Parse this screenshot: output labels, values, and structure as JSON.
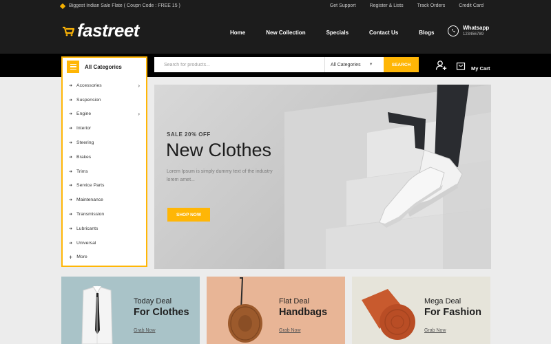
{
  "topbar": {
    "promo": "Biggest Indian Sale Flate ( Coupn Code : FREE 15 )",
    "links": [
      "Get Support",
      "Register & Lists",
      "Track Orders",
      "Credit Card"
    ]
  },
  "header": {
    "logo": "fastreet",
    "nav": [
      "Home",
      "New Collection",
      "Specials",
      "Contact Us",
      "Blogs"
    ],
    "whatsapp_title": "Whatsapp",
    "whatsapp_number": "123456789"
  },
  "categories": {
    "title": "All Categories",
    "items": [
      "Accessories",
      "Suspension",
      "Engine",
      "Interior",
      "Steering",
      "Brakes",
      "Trims",
      "Service Parts",
      "Maintenance",
      "Transmission",
      "Lubricants",
      "Universal"
    ],
    "more": "More"
  },
  "search": {
    "placeholder": "Search for products...",
    "category": "All Categories",
    "button": "SEARCH"
  },
  "cart": {
    "count": "0",
    "label": "My Cart"
  },
  "hero": {
    "kicker": "SALE 20% OFF",
    "title": "New Clothes",
    "description": "Lorem Ipsum is simply dummy text of the industry lorem amet...",
    "button": "SHOP NOW"
  },
  "banners": [
    {
      "line1": "Today Deal",
      "line2": "For Clothes",
      "link": "Grab Now"
    },
    {
      "line1": "Flat Deal",
      "line2": "Handbags",
      "link": "Grab Now"
    },
    {
      "line1": "Mega Deal",
      "line2": "For Fashion",
      "link": "Grab Now"
    }
  ],
  "colors": {
    "accent": "#ffb606",
    "dark": "#1c1c1c"
  }
}
